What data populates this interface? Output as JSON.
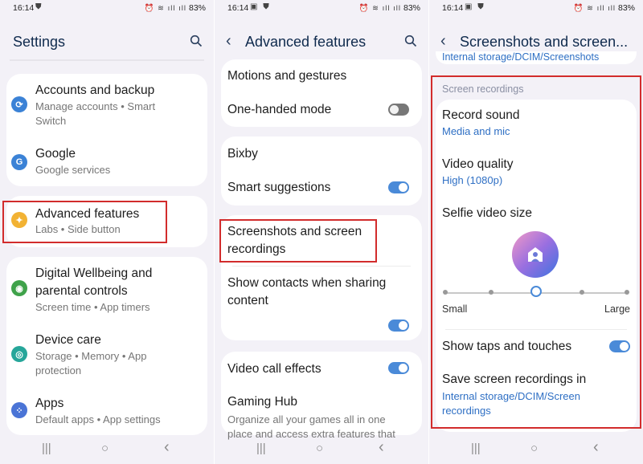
{
  "status": {
    "time": "16:14",
    "battery": "83%"
  },
  "panel1": {
    "title": "Settings",
    "items": [
      {
        "title": "Accounts and backup",
        "subtitle1": "Manage accounts • Smart",
        "subtitle2": "Switch",
        "color": "#3b82d6"
      },
      {
        "title": "Google",
        "subtitle1": "Google services",
        "color": "#3b82d6"
      },
      {
        "title": "Advanced features",
        "subtitle1": "Labs • Side button",
        "color": "#f2b233"
      },
      {
        "title1": "Digital Wellbeing and",
        "title2": "parental controls",
        "subtitle1": "Screen time • App timers",
        "color": "#3fa24a"
      },
      {
        "title": "Device care",
        "subtitle1": "Storage • Memory • App",
        "subtitle2": "protection",
        "color": "#26a69a"
      },
      {
        "title": "Apps",
        "subtitle1": "Default apps • App settings",
        "color": "#4a74d6"
      }
    ]
  },
  "panel2": {
    "title": "Advanced features",
    "items": [
      {
        "title": "Motions and gestures"
      },
      {
        "title": "One-handed mode",
        "toggle": "off"
      },
      {
        "title": "Bixby"
      },
      {
        "title": "Smart suggestions",
        "toggle": "on"
      },
      {
        "title1": "Screenshots and screen",
        "title2": "recordings"
      },
      {
        "title1": "Show contacts when sharing",
        "title2": "content",
        "toggle": "on"
      },
      {
        "title": "Video call effects",
        "toggle": "on"
      },
      {
        "title": "Gaming Hub",
        "subtitle1": "Organize all your games all in one",
        "subtitle2": "place and access extra features that"
      }
    ]
  },
  "panel3": {
    "title": "Screenshots and screen...",
    "prev_subtitle": "Internal storage/DCIM/Screenshots",
    "section": "Screen recordings",
    "record_sound": {
      "title": "Record sound",
      "value": "Media and mic"
    },
    "video_quality": {
      "title": "Video quality",
      "value": "High (1080p)"
    },
    "selfie": {
      "title": "Selfie video size",
      "small": "Small",
      "large": "Large",
      "level": 0.5
    },
    "taps": {
      "title": "Show taps and touches",
      "toggle": "on"
    },
    "save": {
      "title": "Save screen recordings in",
      "value1": "Internal storage/DCIM/Screen",
      "value2": "recordings"
    }
  },
  "nav": {
    "recent": "|||",
    "home": "○",
    "back": "‹"
  },
  "colors": {
    "accent": "#4a8ad8",
    "link": "#2e6fc4",
    "highlight": "#d22c2c"
  }
}
